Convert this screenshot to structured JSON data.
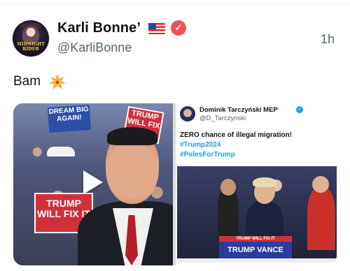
{
  "post": {
    "display_name": "Karli Bonne’",
    "handle": "@KarliBonne",
    "timestamp": "1h",
    "text": "Bam",
    "verified_icon": "checkmark-badge",
    "avatar_logo_text": "MIDNIGHT RIDER"
  },
  "video": {
    "signs": {
      "dream_big": "DREAM BIG AGAIN!",
      "trump_will_fix_it_top": "TRUMP WILL FIX IT",
      "trump_will_fix_it_bottom": "TRUMP WILL FIX IT"
    }
  },
  "quoted_post": {
    "author_name": "Dominik Tarczyński MEP",
    "author_handle": "@D_Tarczynski",
    "line1": "ZERO chance of illegal migration!",
    "hashtag1": "#Trump2024",
    "hashtag2": "#PolesForTrump",
    "podium_sign_top": "TRUMP WILL FIX IT",
    "podium_sign_main": "TRUMP VANCE"
  },
  "colors": {
    "accent_blue": "#1d9bf0",
    "badge_red": "#f0505d",
    "text_secondary": "#536471"
  }
}
